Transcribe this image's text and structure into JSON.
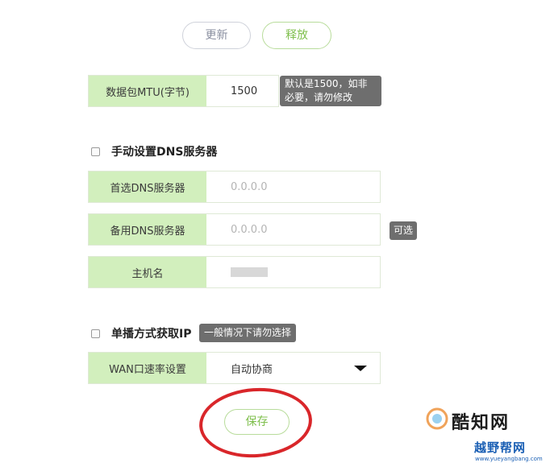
{
  "buttons": {
    "update": "更新",
    "release": "释放",
    "save": "保存"
  },
  "mtu": {
    "label": "数据包MTU(字节)",
    "value": "1500",
    "tip": "默认是1500，如非必要，请勿修改"
  },
  "dns": {
    "checkbox_label": "手动设置DNS服务器",
    "primary_label": "首选DNS服务器",
    "primary_placeholder": "0.0.0.0",
    "secondary_label": "备用DNS服务器",
    "secondary_placeholder": "0.0.0.0",
    "optional_tip": "可选"
  },
  "host": {
    "label": "主机名"
  },
  "unicast": {
    "checkbox_label": "单播方式获取IP",
    "tip": "一般情况下请勿选择"
  },
  "wan": {
    "label": "WAN口速率设置",
    "selected": "自动协商"
  },
  "watermark": {
    "brand1": "酷知网",
    "brand2": "越野帮网",
    "url": "www.yueyangbang.com"
  },
  "colors": {
    "accent_green": "#7fbf4d",
    "label_bg": "#d2efbd",
    "annotation_red": "#d9262a"
  }
}
